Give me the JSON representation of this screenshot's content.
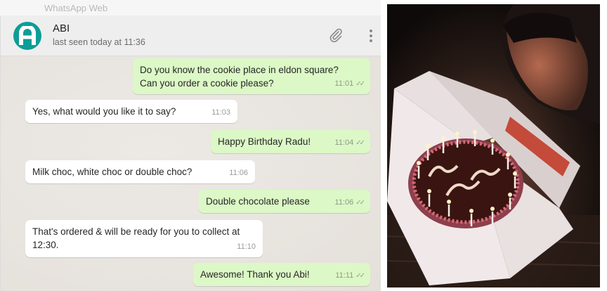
{
  "app": {
    "window_title": "WhatsApp Web"
  },
  "contact": {
    "name": "ABI",
    "status": "last seen today at 11:36",
    "avatar_letter": "A",
    "avatar_color": "#0d9d97"
  },
  "header": {
    "attach_icon": "paperclip-icon",
    "menu_icon": "vertical-dots-icon"
  },
  "messages": [
    {
      "direction": "out",
      "lines": [
        "Do you know the cookie place in eldon square?",
        "Can you order a cookie please?"
      ],
      "time": "11:01",
      "read": true
    },
    {
      "direction": "in",
      "lines": [
        "Yes, what would you like it to say?"
      ],
      "time": "11:03"
    },
    {
      "direction": "out",
      "lines": [
        "Happy Birthday Radu!"
      ],
      "time": "11:04",
      "read": true
    },
    {
      "direction": "in",
      "lines": [
        "Milk choc, white choc or double choc?"
      ],
      "time": "11:06"
    },
    {
      "direction": "out",
      "lines": [
        "Double chocolate please"
      ],
      "time": "11:06",
      "read": true
    },
    {
      "direction": "in",
      "lines": [
        "That's ordered & will be ready for you to collect at",
        "12:30."
      ],
      "time": "11:10"
    },
    {
      "direction": "out",
      "lines": [
        "Awesome! Thank you Abi!"
      ],
      "time": "11:11",
      "read": true
    }
  ],
  "colors": {
    "outgoing_bubble": "#dcf8c6",
    "incoming_bubble": "#ffffff",
    "read_ticks": "#8fa39a"
  }
}
